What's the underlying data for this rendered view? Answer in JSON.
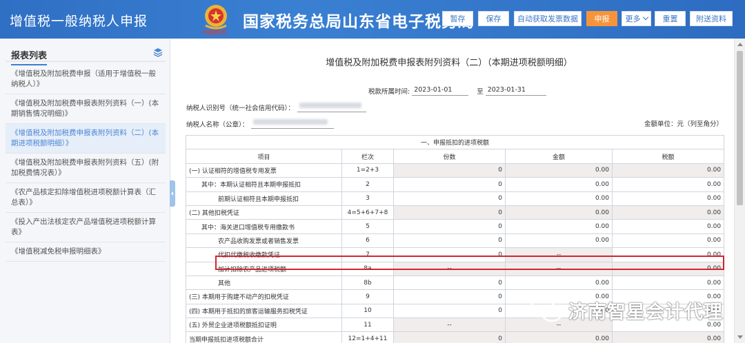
{
  "header": {
    "app_title": "增值税一般纳税人申报",
    "emblem_script": "中国税务",
    "bureau_title": "国家税务总局山东省电子税务局",
    "buttons": {
      "draft": "暂存",
      "save": "保存",
      "auto_fetch": "自动获取发票数据",
      "declare": "申报",
      "more": "更多",
      "reset": "重置",
      "attach": "附送资料"
    }
  },
  "sidebar": {
    "title": "报表列表",
    "items": [
      {
        "label": "《增值税及附加税费申报（适用于增值税一般纳税人）》"
      },
      {
        "label": "《增值税及附加税费申报表附列资料（一）(本期销售情况明细)》"
      },
      {
        "label": "《增值税及附加税费申报表附列资料（二）(本期进项税额明细）》"
      },
      {
        "label": "《增值税及附加税费申报表附列资料（五）(附加税费情况表）》"
      },
      {
        "label": "《农产品核定扣除增值税进项税额计算表（汇总表）》"
      },
      {
        "label": "《投入产出法核定农产品增值税进项税额计算表》"
      },
      {
        "label": "《增值税减免税申报明细表》"
      }
    ]
  },
  "document": {
    "title": "增值税及附加税费申报表附列资料（二）（本期进项税额明细）",
    "period_label": "税款所属时间:",
    "period_start": "2023-01-01",
    "period_to": "至",
    "period_end": "2023-01-31",
    "taxpayer_id_label": "纳税人识别号（统一社会信用代码）：",
    "taxpayer_name_label": "纳税人名称（公章）：",
    "unit_label": "金额单位：元（列至角分）",
    "section_title": "一、申报抵扣的进项税额",
    "columns": [
      "项目",
      "栏次",
      "份数",
      "金额",
      "税额"
    ],
    "rows": [
      {
        "item": "(一) 认证相符的增值税专用发票",
        "line": "1=2+3",
        "count": "0",
        "amount": "0.00",
        "tax": "0.00"
      },
      {
        "item": "其中：本期认证相符且本期申报抵扣",
        "line": "2",
        "count": "0",
        "amount": "0.00",
        "tax": "0.00"
      },
      {
        "item": "前期认证相符且本期申报抵扣",
        "line": "3",
        "count": "0",
        "amount": "0.00",
        "tax": "0.00"
      },
      {
        "item": "(二) 其他扣税凭证",
        "line": "4=5+6+7+8",
        "count": "0",
        "amount": "0.00",
        "tax": "0.00"
      },
      {
        "item": "其中：海关进口增值税专用缴款书",
        "line": "5",
        "count": "0",
        "amount": "0.00",
        "tax": "0.00"
      },
      {
        "item": "农产品收购发票或者销售发票",
        "line": "6",
        "count": "0",
        "amount": "0.00",
        "tax": "0.00"
      },
      {
        "item": "代扣代缴税收缴款凭证",
        "line": "7",
        "count": "0",
        "amount": "--",
        "tax": "0.00"
      },
      {
        "item": "加计扣除农产品进项税额",
        "line": "8a",
        "count": "--",
        "amount": "--",
        "tax": "0.00"
      },
      {
        "item": "其他",
        "line": "8b",
        "count": "0",
        "amount": "0.00",
        "tax": "0.00"
      },
      {
        "item": "(三) 本期用于购建不动产的扣税凭证",
        "line": "9",
        "count": "0",
        "amount": "0.00",
        "tax": "0.00"
      },
      {
        "item": "(四) 本期用于抵扣的旅客运输服务扣税凭证",
        "line": "10",
        "count": "0",
        "amount": "0.00",
        "tax": "0.00"
      },
      {
        "item": "(五) 外贸企业进项税额抵扣证明",
        "line": "11",
        "count": "--",
        "amount": "--",
        "tax": "0.00"
      },
      {
        "item": "当期申报抵扣进项税额合计",
        "line": "12=1+4+11",
        "count": "0",
        "amount": "0.00",
        "tax": "0.00"
      }
    ]
  },
  "watermark": {
    "text": "济南智星会计代理"
  }
}
